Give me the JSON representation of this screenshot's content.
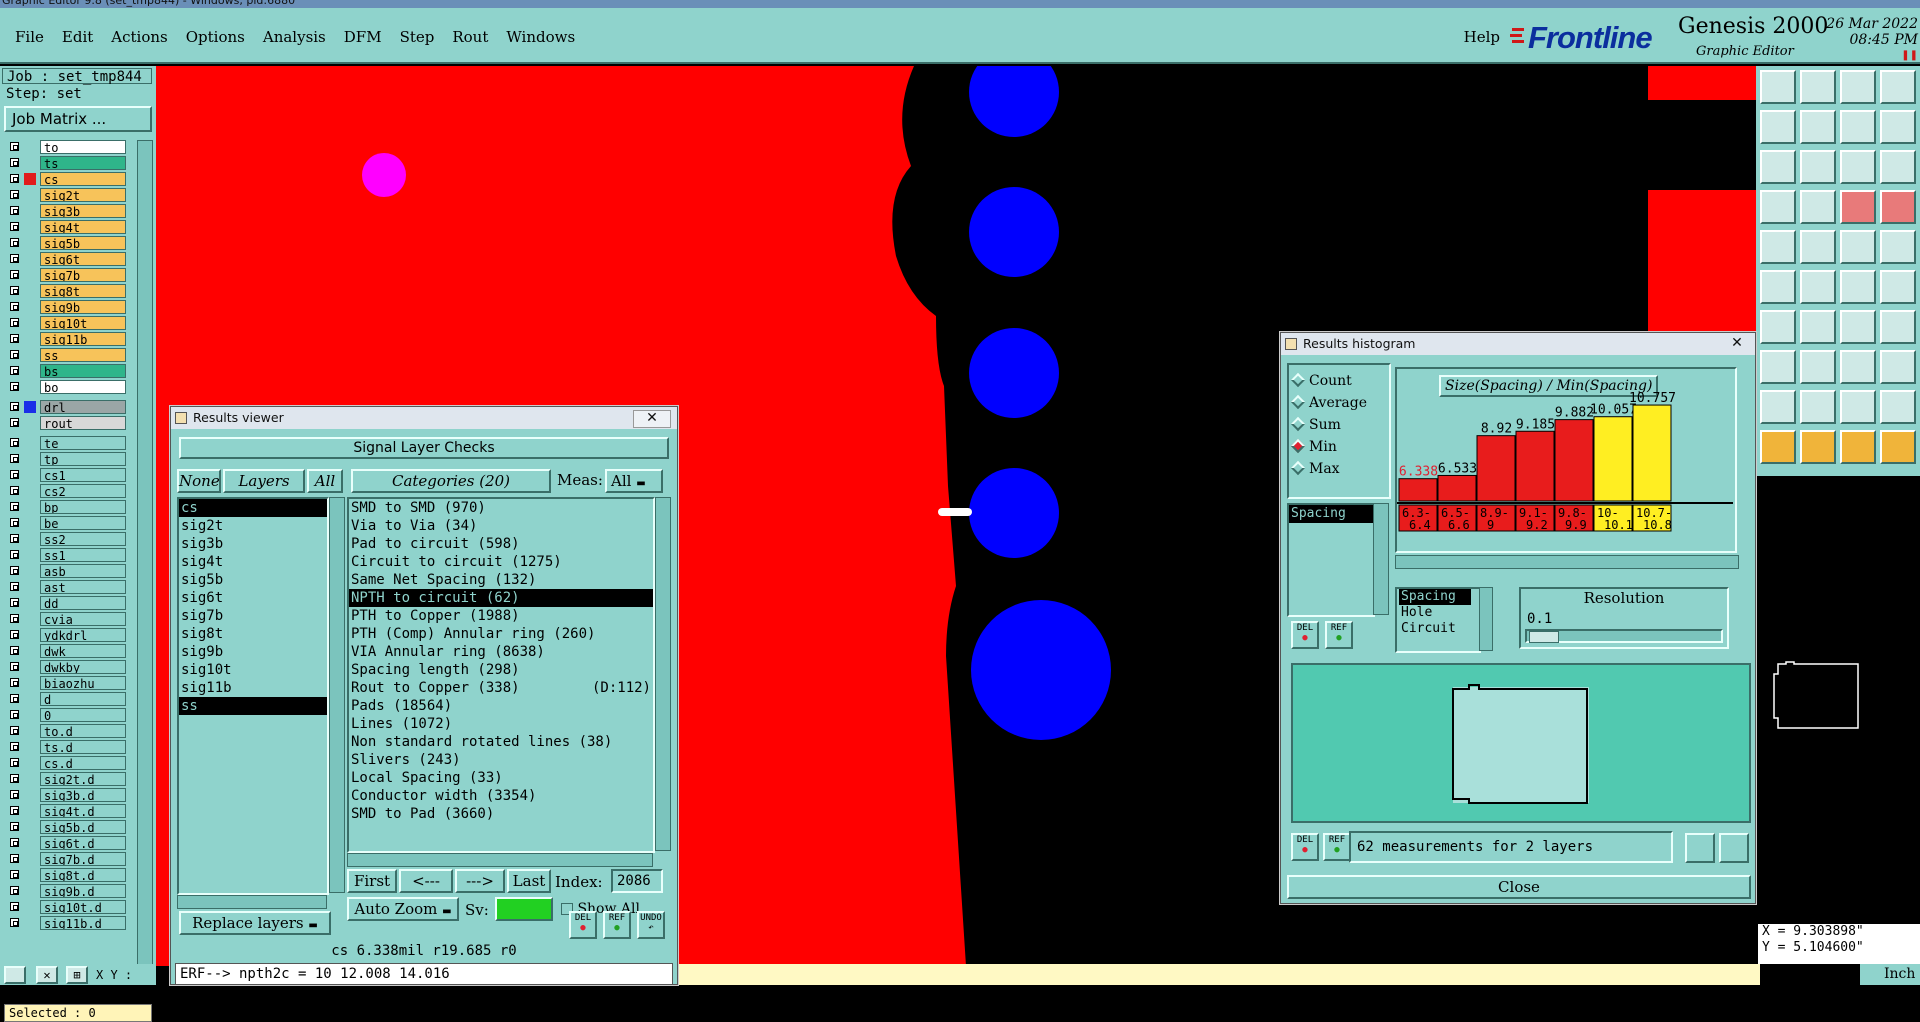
{
  "window_title": "Graphic Editor 9.8 (set_tmp844) - Windows, pid:6880",
  "menubar": {
    "items": [
      "File",
      "Edit",
      "Actions",
      "Options",
      "Analysis",
      "DFM",
      "Step",
      "Rout",
      "Windows"
    ],
    "help": "Help"
  },
  "brand": {
    "logo": "Frontline",
    "product": "Genesis 2000",
    "subtitle": "Graphic Editor",
    "date": "26 Mar 2022",
    "time": "08:45 PM"
  },
  "left": {
    "job": "Job : set_tmp844",
    "step": "Step: set",
    "job_matrix": "Job Matrix ...",
    "selected": "Selected : 0",
    "xy_label": "X Y :"
  },
  "layers": [
    {
      "name": "to",
      "bg": "#ffffff",
      "sw": ""
    },
    {
      "name": "ts",
      "bg": "#2fb58a",
      "sw": ""
    },
    {
      "name": "cs",
      "bg": "#f7c35a",
      "sw": "#e11b1b",
      "active": true
    },
    {
      "name": "sig2t",
      "bg": "#f7c35a",
      "sw": ""
    },
    {
      "name": "sig3b",
      "bg": "#f7c35a",
      "sw": ""
    },
    {
      "name": "sig4t",
      "bg": "#f7c35a",
      "sw": ""
    },
    {
      "name": "sig5b",
      "bg": "#f7c35a",
      "sw": ""
    },
    {
      "name": "sig6t",
      "bg": "#f7c35a",
      "sw": ""
    },
    {
      "name": "sig7b",
      "bg": "#f7c35a",
      "sw": ""
    },
    {
      "name": "sig8t",
      "bg": "#f7c35a",
      "sw": ""
    },
    {
      "name": "sig9b",
      "bg": "#f7c35a",
      "sw": ""
    },
    {
      "name": "sig10t",
      "bg": "#f7c35a",
      "sw": ""
    },
    {
      "name": "sig11b",
      "bg": "#f7c35a",
      "sw": ""
    },
    {
      "name": "ss",
      "bg": "#f7c35a",
      "sw": ""
    },
    {
      "name": "bs",
      "bg": "#2fb58a",
      "sw": ""
    },
    {
      "name": "bo",
      "bg": "#ffffff",
      "sw": ""
    },
    {
      "name": "drl",
      "bg": "#9aa6a6",
      "sw": "#1a2ee8",
      "gap": true
    },
    {
      "name": "rout",
      "bg": "#d8d8d8",
      "sw": ""
    },
    {
      "name": "te",
      "bg": "#8fd3cc",
      "sw": "",
      "gap": true
    },
    {
      "name": "tp",
      "bg": "#8fd3cc",
      "sw": ""
    },
    {
      "name": "cs1",
      "bg": "#8fd3cc",
      "sw": ""
    },
    {
      "name": "cs2",
      "bg": "#8fd3cc",
      "sw": ""
    },
    {
      "name": "bp",
      "bg": "#8fd3cc",
      "sw": ""
    },
    {
      "name": "be",
      "bg": "#8fd3cc",
      "sw": ""
    },
    {
      "name": "ss2",
      "bg": "#8fd3cc",
      "sw": ""
    },
    {
      "name": "ss1",
      "bg": "#8fd3cc",
      "sw": ""
    },
    {
      "name": "asb",
      "bg": "#8fd3cc",
      "sw": ""
    },
    {
      "name": "ast",
      "bg": "#8fd3cc",
      "sw": ""
    },
    {
      "name": "dd",
      "bg": "#8fd3cc",
      "sw": ""
    },
    {
      "name": "cvia",
      "bg": "#8fd3cc",
      "sw": ""
    },
    {
      "name": "ydkdrl",
      "bg": "#8fd3cc",
      "sw": ""
    },
    {
      "name": "dwk",
      "bg": "#8fd3cc",
      "sw": ""
    },
    {
      "name": "dwkby",
      "bg": "#8fd3cc",
      "sw": ""
    },
    {
      "name": "biaozhu",
      "bg": "#8fd3cc",
      "sw": ""
    },
    {
      "name": "d",
      "bg": "#8fd3cc",
      "sw": ""
    },
    {
      "name": "0",
      "bg": "#8fd3cc",
      "sw": ""
    },
    {
      "name": "to.d",
      "bg": "#8fd3cc",
      "sw": ""
    },
    {
      "name": "ts.d",
      "bg": "#8fd3cc",
      "sw": ""
    },
    {
      "name": "cs.d",
      "bg": "#8fd3cc",
      "sw": ""
    },
    {
      "name": "sig2t.d",
      "bg": "#8fd3cc",
      "sw": ""
    },
    {
      "name": "sig3b.d",
      "bg": "#8fd3cc",
      "sw": ""
    },
    {
      "name": "sig4t.d",
      "bg": "#8fd3cc",
      "sw": ""
    },
    {
      "name": "sig5b.d",
      "bg": "#8fd3cc",
      "sw": ""
    },
    {
      "name": "sig6t.d",
      "bg": "#8fd3cc",
      "sw": ""
    },
    {
      "name": "sig7b.d",
      "bg": "#8fd3cc",
      "sw": ""
    },
    {
      "name": "sig8t.d",
      "bg": "#8fd3cc",
      "sw": ""
    },
    {
      "name": "sig9b.d",
      "bg": "#8fd3cc",
      "sw": ""
    },
    {
      "name": "sig10t.d",
      "bg": "#8fd3cc",
      "sw": ""
    },
    {
      "name": "sig11b.d",
      "bg": "#8fd3cc",
      "sw": ""
    }
  ],
  "results_viewer": {
    "title": "Results viewer",
    "header": "Signal Layer Checks",
    "none_btn": "None",
    "layers_btn": "Layers",
    "all_btn": "All",
    "categories_btn": "Categories (20)",
    "meas_label": "Meas:",
    "meas_value": "All",
    "layers": [
      "cs",
      "sig2t",
      "sig3b",
      "sig4t",
      "sig5b",
      "sig6t",
      "sig7b",
      "sig8t",
      "sig9b",
      "sig10t",
      "sig11b",
      "ss"
    ],
    "selected_layers": [
      "cs",
      "ss"
    ],
    "categories": [
      "SMD to SMD (970)",
      "Via to Via (34)",
      "Pad to circuit (598)",
      "Circuit to circuit (1275)",
      "Same Net Spacing (132)",
      "NPTH to circuit (62)",
      "PTH to Copper (1988)",
      "PTH (Comp) Annular ring (260)",
      "VIA Annular ring (8638)",
      "Spacing length (298)",
      "Rout to Copper (338)",
      "Pads (18564)",
      "Lines (1072)",
      "Non standard rotated lines (38)",
      "Slivers (243)",
      "Local Spacing (33)",
      "Conductor width (3354)",
      "SMD to Pad (3660)"
    ],
    "selected_category": "NPTH to circuit (62)",
    "rout_suffix": "(D:112)",
    "first": "First",
    "prev": "<---",
    "next": "--->",
    "last": "Last",
    "index_label": "Index:",
    "index_value": "2086",
    "autozoom": "Auto Zoom",
    "sv_label": "Sv:",
    "show_all": "Show All",
    "replace": "Replace layers",
    "del": "DEL",
    "ref": "REF",
    "undo": "UNDO",
    "status": "cs 6.338mil  r19.685  r0",
    "erf": "ERF--> npth2c = 10 12.008 14.016"
  },
  "histogram": {
    "title": "Results histogram",
    "chart_title": "Size(Spacing) / Min(Spacing)",
    "options": [
      {
        "label": "Count",
        "on": false
      },
      {
        "label": "Average",
        "on": false
      },
      {
        "label": "Sum",
        "on": false
      },
      {
        "label": "Min",
        "on": true
      },
      {
        "label": "Max",
        "on": false
      }
    ],
    "left_list": [
      "Spacing"
    ],
    "type_list": [
      "Spacing",
      "Hole",
      "Circuit"
    ],
    "resolution_label": "Resolution",
    "resolution_value": "0.1",
    "measurements": "62 measurements for 2 layers",
    "close": "Close",
    "del": "DEL",
    "ref": "REF"
  },
  "chart_data": {
    "type": "bar",
    "title": "Size(Spacing) / Min(Spacing)",
    "categories": [
      "6.3-6.4",
      "6.5-6.6",
      "8.9-9",
      "9.1-9.2",
      "9.8-9.9",
      "10-10.1",
      "10.7-10.8"
    ],
    "values": [
      6.338,
      6.533,
      8.92,
      9.185,
      9.882,
      10.057,
      10.757
    ],
    "value_labels": [
      "6.338",
      "6.533",
      "8.92",
      "9.185",
      "9.882",
      "10.057",
      "10.757"
    ],
    "bar_colors": [
      "#e81c1c",
      "#e81c1c",
      "#e81c1c",
      "#e81c1c",
      "#e81c1c",
      "#ffee22",
      "#ffee22"
    ],
    "ylim": [
      0,
      11
    ]
  },
  "status": {
    "x": "X = 9.303898\"",
    "y": "Y = 5.104600\"",
    "unit": "Inch"
  },
  "colors": {
    "teal": "#8fd3cc",
    "red": "#ff0000",
    "blue": "#0000ff",
    "magenta": "#ff00ff"
  }
}
